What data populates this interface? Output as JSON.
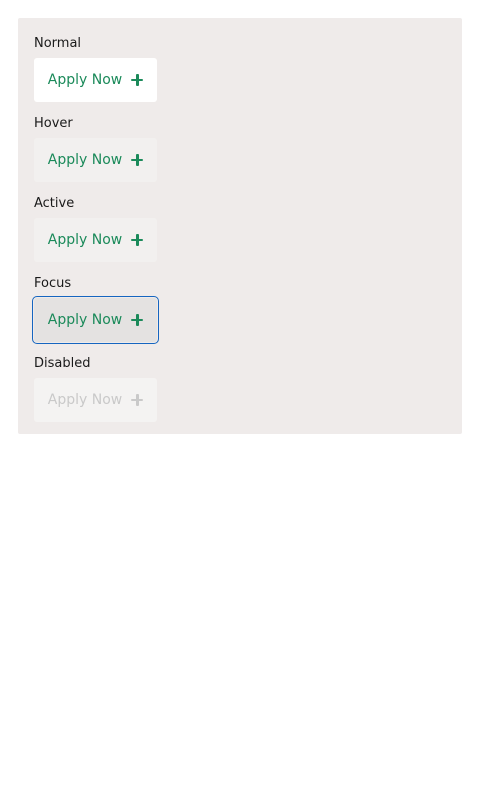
{
  "states": [
    {
      "label": "Normal",
      "button_label": "Apply Now"
    },
    {
      "label": "Hover",
      "button_label": "Apply Now"
    },
    {
      "label": "Active",
      "button_label": "Apply Now"
    },
    {
      "label": "Focus",
      "button_label": "Apply Now"
    },
    {
      "label": "Disabled",
      "button_label": "Apply Now"
    }
  ],
  "icon": "plus-icon",
  "colors": {
    "accent": "#1b8a5a",
    "panel_bg": "#efebea",
    "focus_outline": "#1565c0",
    "disabled_text": "#c9c9c9"
  }
}
